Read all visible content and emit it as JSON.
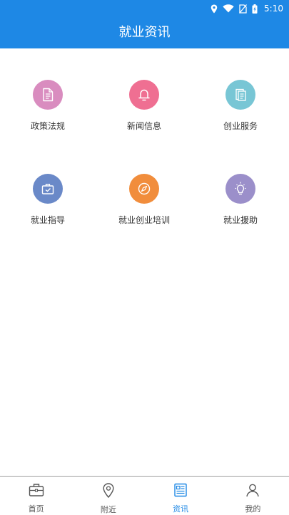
{
  "status_bar": {
    "time": "5:10"
  },
  "header": {
    "title": "就业资讯"
  },
  "grid": [
    {
      "label": "政策法规",
      "color": "#d98cbf",
      "icon": "document-icon"
    },
    {
      "label": "新闻信息",
      "color": "#ef6f92",
      "icon": "bell-icon"
    },
    {
      "label": "创业服务",
      "color": "#78c6d5",
      "icon": "report-icon"
    },
    {
      "label": "就业指导",
      "color": "#6a89c8",
      "icon": "briefcase-icon"
    },
    {
      "label": "就业创业培训",
      "color": "#f18d3c",
      "icon": "compass-icon"
    },
    {
      "label": "就业援助",
      "color": "#9b8fca",
      "icon": "lightbulb-icon"
    }
  ],
  "tabs": [
    {
      "label": "首页",
      "icon": "briefcase-icon",
      "active": false
    },
    {
      "label": "附近",
      "icon": "location-pin-icon",
      "active": false
    },
    {
      "label": "资讯",
      "icon": "news-icon",
      "active": true
    },
    {
      "label": "我的",
      "icon": "person-icon",
      "active": false
    }
  ],
  "colors": {
    "primary": "#1e88e5",
    "text": "#333333",
    "tab_text": "#555555"
  }
}
